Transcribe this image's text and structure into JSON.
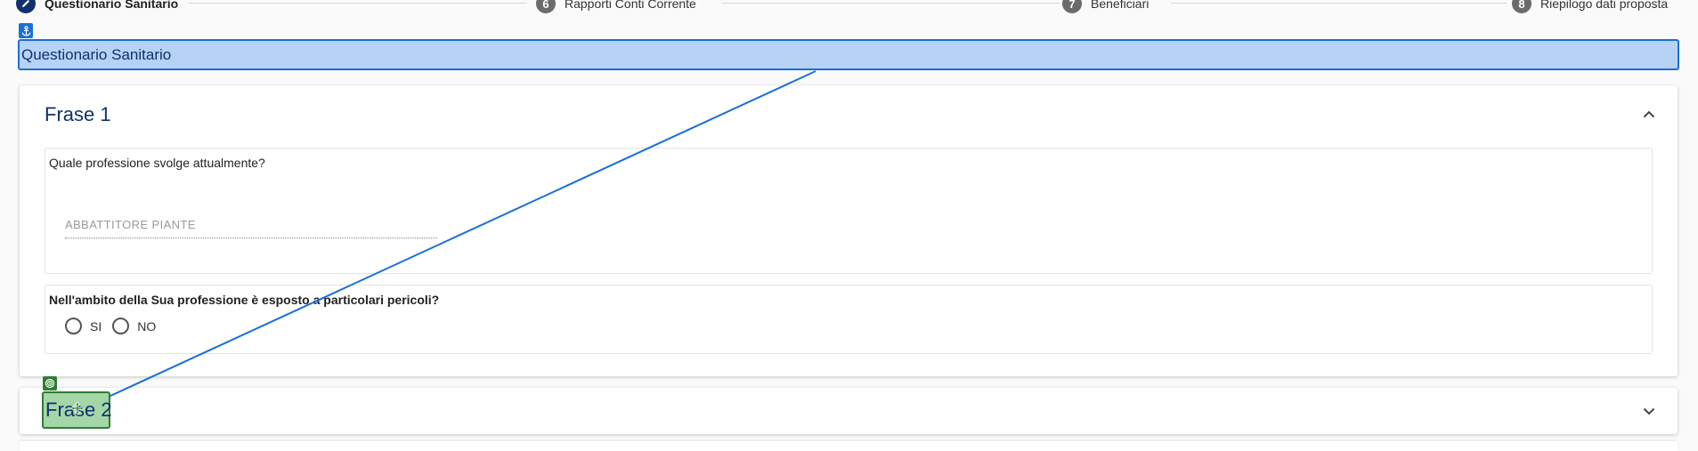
{
  "stepper": {
    "steps": [
      {
        "number": "",
        "label": "Questionario Sanitario",
        "active": true
      },
      {
        "number": "6",
        "label": "Rapporti Conti Corrente",
        "active": false
      },
      {
        "number": "7",
        "label": "Beneficiari",
        "active": false
      },
      {
        "number": "8",
        "label": "Riepilogo dati proposta",
        "active": false
      }
    ]
  },
  "section": {
    "header": "Questionario Sanitario"
  },
  "card1": {
    "title": "Frase 1",
    "question1": {
      "text": "Quale professione svolge attualmente?",
      "answer": "ABBATTITORE PIANTE"
    },
    "question2": {
      "text": "Nell'ambito della Sua professione è esposto a particolari pericoli?",
      "options": [
        "SI",
        "NO"
      ]
    }
  },
  "card2": {
    "title": "Frase 2"
  },
  "colors": {
    "accent": "#10316b",
    "anchor_highlight": "#1a6fd8",
    "target_highlight": "#2e7d32"
  },
  "icons": {
    "edit": "pencil-icon",
    "anchor": "anchor-icon",
    "target": "target-icon",
    "collapse": "chevron-up-icon",
    "expand": "chevron-down-icon",
    "move": "move-icon"
  }
}
